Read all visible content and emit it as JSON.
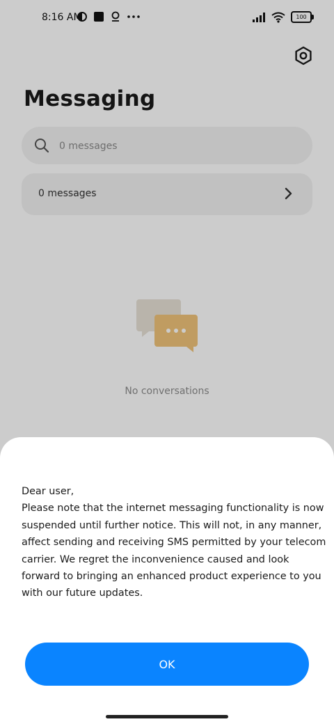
{
  "status_bar": {
    "time": "8:16 AM",
    "left_icons": [
      "app-notification-icon",
      "square-notification-icon",
      "location-icon",
      "more-dots-icon"
    ],
    "right_icons": [
      "signal-icon",
      "wifi-icon",
      "battery-icon"
    ],
    "battery_level": "100"
  },
  "header": {
    "title": "Messaging",
    "settings_icon": "settings-icon"
  },
  "search": {
    "placeholder": "0 messages"
  },
  "messages_row": {
    "label": "0 messages"
  },
  "empty_state": {
    "text": "No conversations",
    "illustration_color": "#f1c47a"
  },
  "dialog": {
    "message": "Dear user,\nPlease note that the internet messaging functionality is now suspended until further notice. This will not, in any manner, affect sending and receiving SMS permitted by your telecom carrier. We regret the inconvenience caused and look forward to bringing an enhanced product experience to you with our future updates.",
    "ok_label": "OK",
    "accent_color": "#0a84ff"
  }
}
